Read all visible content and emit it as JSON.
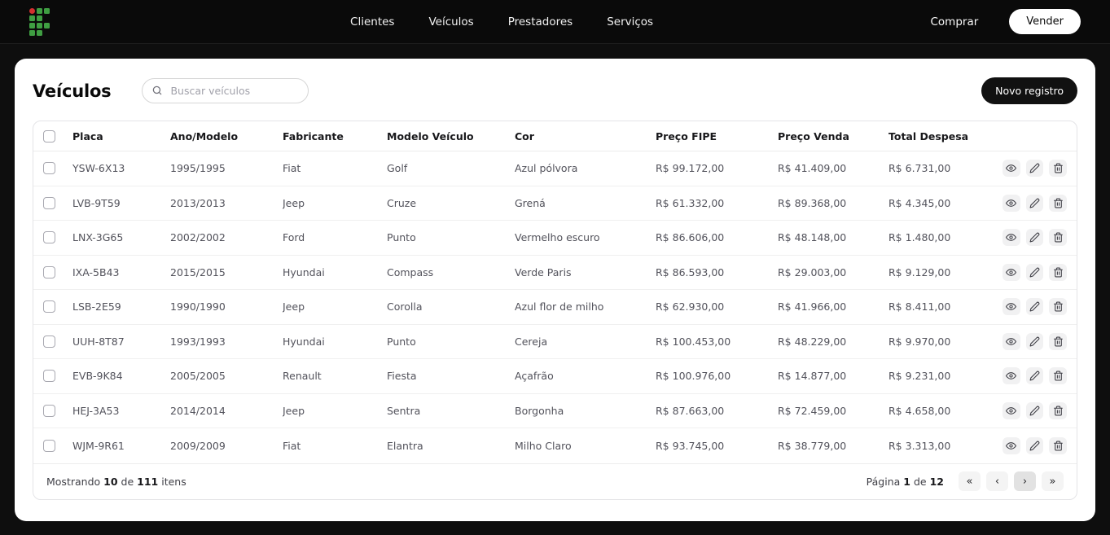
{
  "nav": {
    "items": [
      {
        "label": "Clientes"
      },
      {
        "label": "Veículos"
      },
      {
        "label": "Prestadores"
      },
      {
        "label": "Serviços"
      }
    ],
    "comprar_label": "Comprar",
    "vender_label": "Vender"
  },
  "page": {
    "title": "Veículos",
    "search_placeholder": "Buscar veículos",
    "new_record_label": "Novo registro"
  },
  "icons": {
    "logo": "if-square-grid-logo",
    "search": "magnifier",
    "view": "eye",
    "edit": "pencil",
    "delete": "trash"
  },
  "colors": {
    "nav_bg": "#0a0a0a",
    "page_bg": "#0e0e0e",
    "card_bg": "#ffffff",
    "logo_green": "#3f9e42",
    "logo_red": "#d32f2f",
    "primary_button_bg": "#111111",
    "table_border": "#e4e4e7"
  },
  "table": {
    "columns": [
      "Placa",
      "Ano/Modelo",
      "Fabricante",
      "Modelo Veículo",
      "Cor",
      "Preço FIPE",
      "Preço Venda",
      "Total Despesa"
    ],
    "rows": [
      {
        "placa": "YSW-6X13",
        "ano_modelo": "1995/1995",
        "fabricante": "Fiat",
        "modelo": "Golf",
        "cor": "Azul pólvora",
        "preco_fipe": "R$ 99.172,00",
        "preco_venda": "R$ 41.409,00",
        "total_despesa": "R$ 6.731,00"
      },
      {
        "placa": "LVB-9T59",
        "ano_modelo": "2013/2013",
        "fabricante": "Jeep",
        "modelo": "Cruze",
        "cor": "Grená",
        "preco_fipe": "R$ 61.332,00",
        "preco_venda": "R$ 89.368,00",
        "total_despesa": "R$ 4.345,00"
      },
      {
        "placa": "LNX-3G65",
        "ano_modelo": "2002/2002",
        "fabricante": "Ford",
        "modelo": "Punto",
        "cor": "Vermelho escuro",
        "preco_fipe": "R$ 86.606,00",
        "preco_venda": "R$ 48.148,00",
        "total_despesa": "R$ 1.480,00"
      },
      {
        "placa": "IXA-5B43",
        "ano_modelo": "2015/2015",
        "fabricante": "Hyundai",
        "modelo": "Compass",
        "cor": "Verde Paris",
        "preco_fipe": "R$ 86.593,00",
        "preco_venda": "R$ 29.003,00",
        "total_despesa": "R$ 9.129,00"
      },
      {
        "placa": "LSB-2E59",
        "ano_modelo": "1990/1990",
        "fabricante": "Jeep",
        "modelo": "Corolla",
        "cor": "Azul flor de milho",
        "preco_fipe": "R$ 62.930,00",
        "preco_venda": "R$ 41.966,00",
        "total_despesa": "R$ 8.411,00"
      },
      {
        "placa": "UUH-8T87",
        "ano_modelo": "1993/1993",
        "fabricante": "Hyundai",
        "modelo": "Punto",
        "cor": "Cereja",
        "preco_fipe": "R$ 100.453,00",
        "preco_venda": "R$ 48.229,00",
        "total_despesa": "R$ 9.970,00"
      },
      {
        "placa": "EVB-9K84",
        "ano_modelo": "2005/2005",
        "fabricante": "Renault",
        "modelo": "Fiesta",
        "cor": "Açafrão",
        "preco_fipe": "R$ 100.976,00",
        "preco_venda": "R$ 14.877,00",
        "total_despesa": "R$ 9.231,00"
      },
      {
        "placa": "HEJ-3A53",
        "ano_modelo": "2014/2014",
        "fabricante": "Jeep",
        "modelo": "Sentra",
        "cor": "Borgonha",
        "preco_fipe": "R$ 87.663,00",
        "preco_venda": "R$ 72.459,00",
        "total_despesa": "R$ 4.658,00"
      },
      {
        "placa": "WJM-9R61",
        "ano_modelo": "2009/2009",
        "fabricante": "Fiat",
        "modelo": "Elantra",
        "cor": "Milho Claro",
        "preco_fipe": "R$ 93.745,00",
        "preco_venda": "R$ 38.779,00",
        "total_despesa": "R$ 3.313,00"
      }
    ]
  },
  "footer": {
    "showing": {
      "prefix": "Mostrando",
      "count": "10",
      "of": "de",
      "total": "111",
      "suffix": "itens"
    },
    "page": {
      "prefix": "Página",
      "current": "1",
      "of": "de",
      "total": "12"
    },
    "buttons": {
      "first": "«",
      "prev": "‹",
      "next": "›",
      "last": "»"
    }
  }
}
